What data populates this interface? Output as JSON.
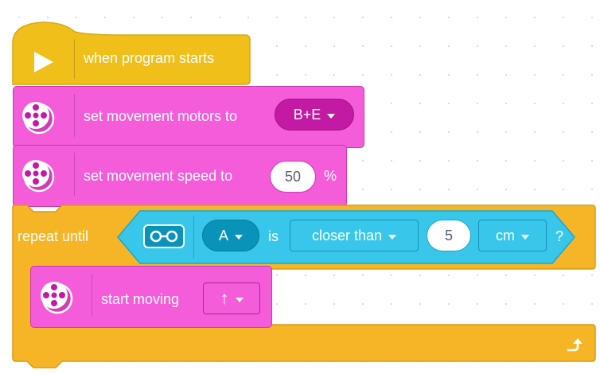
{
  "program": {
    "hat_label": "when program starts",
    "set_motors": {
      "label": "set movement motors to",
      "value": "B+E"
    },
    "set_speed": {
      "label": "set movement speed to",
      "value": "50",
      "unit": "%"
    },
    "repeat": {
      "label": "repeat until",
      "condition": {
        "port": "A",
        "is_label": "is",
        "comparison": "closer than",
        "distance": "5",
        "unit": "cm",
        "suffix": "?"
      },
      "body": {
        "start_moving": {
          "label": "start moving",
          "direction": "↑"
        }
      }
    }
  },
  "icons": {
    "hat": "play-icon",
    "motor": "motor-pair-icon",
    "sensor": "distance-sensor-icon",
    "loop_end": "loop-arrow-icon"
  },
  "colors": {
    "events": "#f1bf1a",
    "events_border": "#d9a90f",
    "movement": "#f45cd9",
    "movement_border": "#c93ab1",
    "movement_dark": "#c21aa3",
    "control": "#f6b526",
    "control_border": "#d99b12",
    "sensor": "#38c7ea",
    "sensor_border": "#1aa7cc",
    "sensor_dark": "#0a93b8"
  }
}
